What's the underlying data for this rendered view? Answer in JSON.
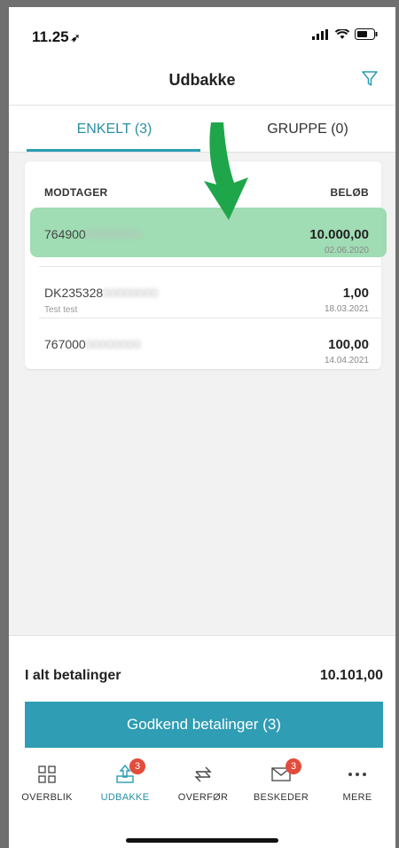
{
  "status": {
    "time": "11.25"
  },
  "header": {
    "title": "Udbakke"
  },
  "tabs": [
    {
      "label": "ENKELT (3)"
    },
    {
      "label": "GRUPPE (0)"
    }
  ],
  "table": {
    "col_left": "MODTAGER",
    "col_right": "BELØB",
    "rows": [
      {
        "recipient": "764900",
        "recipient_hidden": "00000000",
        "note": "",
        "amount": "10.000,00",
        "date": "02.06.2020"
      },
      {
        "recipient": "DK235328",
        "recipient_hidden": "00000000",
        "note": "Test test",
        "amount": "1,00",
        "date": "18.03.2021"
      },
      {
        "recipient": "767000",
        "recipient_hidden": "00000000",
        "note": "",
        "amount": "100,00",
        "date": "14.04.2021"
      }
    ]
  },
  "summary": {
    "label": "I alt betalinger",
    "value": "10.101,00"
  },
  "approve_button": {
    "label": "Godkend betalinger (3)"
  },
  "nav": {
    "items": [
      {
        "label": "OVERBLIK",
        "icon": "grid-icon"
      },
      {
        "label": "UDBAKKE",
        "icon": "outbox-icon",
        "badge": "3"
      },
      {
        "label": "OVERFØR",
        "icon": "transfer-icon"
      },
      {
        "label": "BESKEDER",
        "icon": "mail-icon",
        "badge": "3"
      },
      {
        "label": "MERE",
        "icon": "more-icon"
      }
    ]
  },
  "colors": {
    "accent": "#2a9db3",
    "badge": "#e24c3b",
    "highlight": "#8fd6a7",
    "arrow": "#1fa64a"
  }
}
